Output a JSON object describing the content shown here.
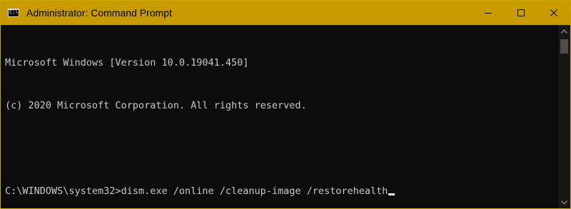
{
  "window": {
    "title": "Administrator: Command Prompt",
    "titlebar_color": "#c69a00"
  },
  "console": {
    "lines": [
      "Microsoft Windows [Version 10.0.19041.450]",
      "(c) 2020 Microsoft Corporation. All rights reserved.",
      "",
      "C:\\WINDOWS\\system32>dism.exe /online /cleanup-image /restorehealth"
    ]
  },
  "icons": {
    "app": "cmd-icon",
    "minimize": "minimize-icon",
    "maximize": "maximize-icon",
    "close": "close-icon"
  }
}
